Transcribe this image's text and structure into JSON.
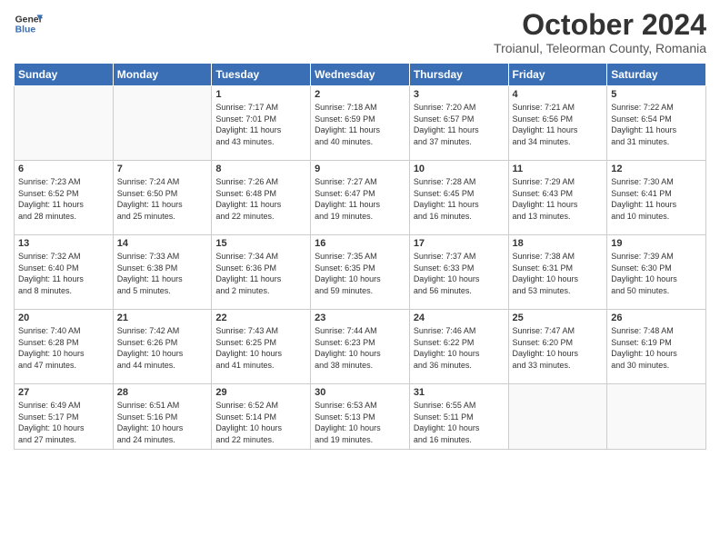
{
  "header": {
    "logo_line1": "General",
    "logo_line2": "Blue",
    "month": "October 2024",
    "location": "Troianul, Teleorman County, Romania"
  },
  "weekdays": [
    "Sunday",
    "Monday",
    "Tuesday",
    "Wednesday",
    "Thursday",
    "Friday",
    "Saturday"
  ],
  "weeks": [
    [
      {
        "day": "",
        "info": ""
      },
      {
        "day": "",
        "info": ""
      },
      {
        "day": "1",
        "info": "Sunrise: 7:17 AM\nSunset: 7:01 PM\nDaylight: 11 hours\nand 43 minutes."
      },
      {
        "day": "2",
        "info": "Sunrise: 7:18 AM\nSunset: 6:59 PM\nDaylight: 11 hours\nand 40 minutes."
      },
      {
        "day": "3",
        "info": "Sunrise: 7:20 AM\nSunset: 6:57 PM\nDaylight: 11 hours\nand 37 minutes."
      },
      {
        "day": "4",
        "info": "Sunrise: 7:21 AM\nSunset: 6:56 PM\nDaylight: 11 hours\nand 34 minutes."
      },
      {
        "day": "5",
        "info": "Sunrise: 7:22 AM\nSunset: 6:54 PM\nDaylight: 11 hours\nand 31 minutes."
      }
    ],
    [
      {
        "day": "6",
        "info": "Sunrise: 7:23 AM\nSunset: 6:52 PM\nDaylight: 11 hours\nand 28 minutes."
      },
      {
        "day": "7",
        "info": "Sunrise: 7:24 AM\nSunset: 6:50 PM\nDaylight: 11 hours\nand 25 minutes."
      },
      {
        "day": "8",
        "info": "Sunrise: 7:26 AM\nSunset: 6:48 PM\nDaylight: 11 hours\nand 22 minutes."
      },
      {
        "day": "9",
        "info": "Sunrise: 7:27 AM\nSunset: 6:47 PM\nDaylight: 11 hours\nand 19 minutes."
      },
      {
        "day": "10",
        "info": "Sunrise: 7:28 AM\nSunset: 6:45 PM\nDaylight: 11 hours\nand 16 minutes."
      },
      {
        "day": "11",
        "info": "Sunrise: 7:29 AM\nSunset: 6:43 PM\nDaylight: 11 hours\nand 13 minutes."
      },
      {
        "day": "12",
        "info": "Sunrise: 7:30 AM\nSunset: 6:41 PM\nDaylight: 11 hours\nand 10 minutes."
      }
    ],
    [
      {
        "day": "13",
        "info": "Sunrise: 7:32 AM\nSunset: 6:40 PM\nDaylight: 11 hours\nand 8 minutes."
      },
      {
        "day": "14",
        "info": "Sunrise: 7:33 AM\nSunset: 6:38 PM\nDaylight: 11 hours\nand 5 minutes."
      },
      {
        "day": "15",
        "info": "Sunrise: 7:34 AM\nSunset: 6:36 PM\nDaylight: 11 hours\nand 2 minutes."
      },
      {
        "day": "16",
        "info": "Sunrise: 7:35 AM\nSunset: 6:35 PM\nDaylight: 10 hours\nand 59 minutes."
      },
      {
        "day": "17",
        "info": "Sunrise: 7:37 AM\nSunset: 6:33 PM\nDaylight: 10 hours\nand 56 minutes."
      },
      {
        "day": "18",
        "info": "Sunrise: 7:38 AM\nSunset: 6:31 PM\nDaylight: 10 hours\nand 53 minutes."
      },
      {
        "day": "19",
        "info": "Sunrise: 7:39 AM\nSunset: 6:30 PM\nDaylight: 10 hours\nand 50 minutes."
      }
    ],
    [
      {
        "day": "20",
        "info": "Sunrise: 7:40 AM\nSunset: 6:28 PM\nDaylight: 10 hours\nand 47 minutes."
      },
      {
        "day": "21",
        "info": "Sunrise: 7:42 AM\nSunset: 6:26 PM\nDaylight: 10 hours\nand 44 minutes."
      },
      {
        "day": "22",
        "info": "Sunrise: 7:43 AM\nSunset: 6:25 PM\nDaylight: 10 hours\nand 41 minutes."
      },
      {
        "day": "23",
        "info": "Sunrise: 7:44 AM\nSunset: 6:23 PM\nDaylight: 10 hours\nand 38 minutes."
      },
      {
        "day": "24",
        "info": "Sunrise: 7:46 AM\nSunset: 6:22 PM\nDaylight: 10 hours\nand 36 minutes."
      },
      {
        "day": "25",
        "info": "Sunrise: 7:47 AM\nSunset: 6:20 PM\nDaylight: 10 hours\nand 33 minutes."
      },
      {
        "day": "26",
        "info": "Sunrise: 7:48 AM\nSunset: 6:19 PM\nDaylight: 10 hours\nand 30 minutes."
      }
    ],
    [
      {
        "day": "27",
        "info": "Sunrise: 6:49 AM\nSunset: 5:17 PM\nDaylight: 10 hours\nand 27 minutes."
      },
      {
        "day": "28",
        "info": "Sunrise: 6:51 AM\nSunset: 5:16 PM\nDaylight: 10 hours\nand 24 minutes."
      },
      {
        "day": "29",
        "info": "Sunrise: 6:52 AM\nSunset: 5:14 PM\nDaylight: 10 hours\nand 22 minutes."
      },
      {
        "day": "30",
        "info": "Sunrise: 6:53 AM\nSunset: 5:13 PM\nDaylight: 10 hours\nand 19 minutes."
      },
      {
        "day": "31",
        "info": "Sunrise: 6:55 AM\nSunset: 5:11 PM\nDaylight: 10 hours\nand 16 minutes."
      },
      {
        "day": "",
        "info": ""
      },
      {
        "day": "",
        "info": ""
      }
    ]
  ]
}
